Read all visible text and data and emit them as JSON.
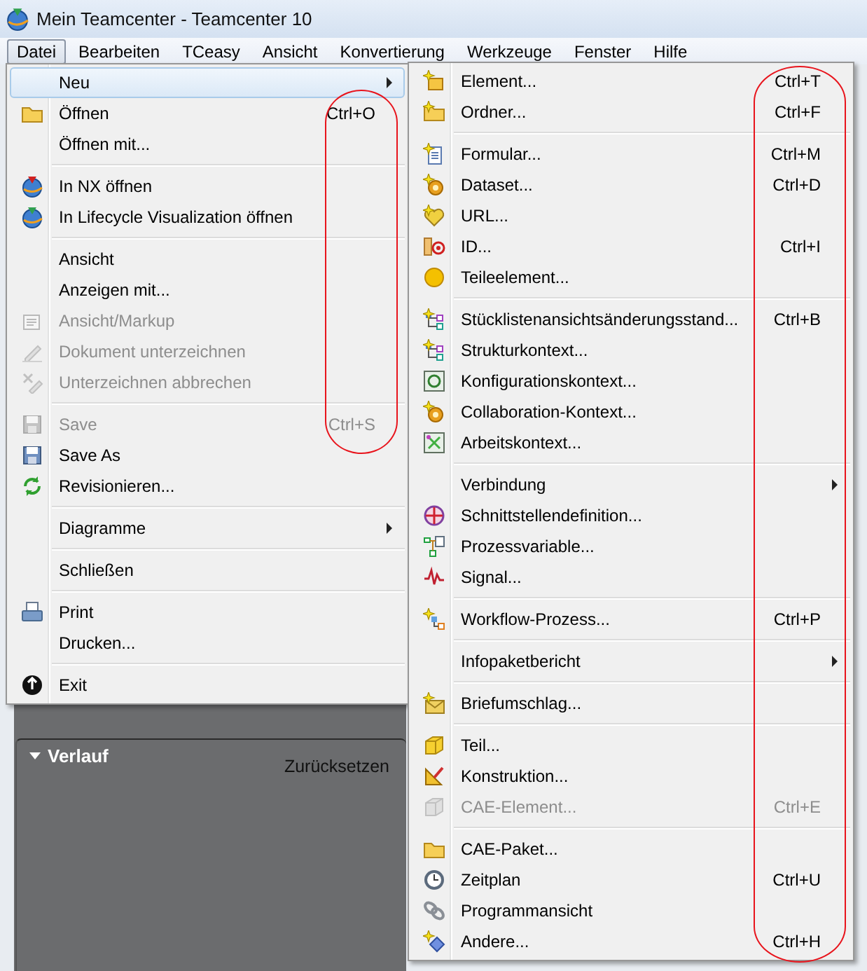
{
  "window": {
    "title": "Mein Teamcenter - Teamcenter 10"
  },
  "menu_bar": [
    {
      "label": "Datei",
      "selected": true
    },
    {
      "label": "Bearbeiten",
      "selected": false
    },
    {
      "label": "TCeasy",
      "selected": false
    },
    {
      "label": "Ansicht",
      "selected": false
    },
    {
      "label": "Konvertierung",
      "selected": false
    },
    {
      "label": "Werkzeuge",
      "selected": false
    },
    {
      "label": "Fenster",
      "selected": false
    },
    {
      "label": "Hilfe",
      "selected": false
    }
  ],
  "file_menu": {
    "groups": [
      {
        "items": [
          {
            "label": "Neu",
            "selected": true,
            "disabled": false,
            "submenu": true
          },
          {
            "label": "Öffnen",
            "shortcut": "Ctrl+O",
            "selected": false,
            "disabled": false,
            "submenu": false
          },
          {
            "label": "Öffnen mit...",
            "selected": false,
            "disabled": false,
            "submenu": false
          }
        ]
      },
      {
        "items": [
          {
            "label": "In NX öffnen",
            "selected": false,
            "disabled": false,
            "submenu": false
          },
          {
            "label": "In Lifecycle Visualization öffnen",
            "selected": false,
            "disabled": false,
            "submenu": false
          }
        ]
      },
      {
        "items": [
          {
            "label": "Ansicht",
            "selected": false,
            "disabled": false,
            "submenu": false
          },
          {
            "label": "Anzeigen mit...",
            "selected": false,
            "disabled": false,
            "submenu": false
          },
          {
            "label": "Ansicht/Markup",
            "selected": false,
            "disabled": true,
            "submenu": false
          },
          {
            "label": "Dokument unterzeichnen",
            "selected": false,
            "disabled": true,
            "submenu": false
          },
          {
            "label": "Unterzeichnen abbrechen",
            "selected": false,
            "disabled": true,
            "submenu": false
          }
        ]
      },
      {
        "items": [
          {
            "label": "Save",
            "shortcut": "Ctrl+S",
            "selected": false,
            "disabled": true,
            "submenu": false
          },
          {
            "label": "Save As",
            "selected": false,
            "disabled": false,
            "submenu": false
          },
          {
            "label": "Revisionieren...",
            "selected": false,
            "disabled": false,
            "submenu": false
          }
        ]
      },
      {
        "items": [
          {
            "label": "Diagramme",
            "selected": false,
            "disabled": false,
            "submenu": true
          }
        ]
      },
      {
        "items": [
          {
            "label": "Schließen",
            "selected": false,
            "disabled": false,
            "submenu": false
          }
        ]
      },
      {
        "items": [
          {
            "label": "Print",
            "selected": false,
            "disabled": false,
            "submenu": false
          },
          {
            "label": "Drucken...",
            "selected": false,
            "disabled": false,
            "submenu": false
          }
        ]
      },
      {
        "items": [
          {
            "label": "Exit",
            "selected": false,
            "disabled": false,
            "submenu": false
          }
        ]
      }
    ]
  },
  "new_submenu": {
    "groups": [
      {
        "items": [
          {
            "label": "Element...",
            "shortcut": "Ctrl+T",
            "selected": false,
            "disabled": false,
            "submenu": false
          },
          {
            "label": "Ordner...",
            "shortcut": "Ctrl+F",
            "selected": false,
            "disabled": false,
            "submenu": false
          }
        ]
      },
      {
        "items": [
          {
            "label": "Formular...",
            "shortcut": "Ctrl+M",
            "selected": false,
            "disabled": false,
            "submenu": false
          },
          {
            "label": "Dataset...",
            "shortcut": "Ctrl+D",
            "selected": false,
            "disabled": false,
            "submenu": false
          },
          {
            "label": "URL...",
            "selected": false,
            "disabled": false,
            "submenu": false
          },
          {
            "label": "ID...",
            "shortcut": "Ctrl+I",
            "selected": false,
            "disabled": false,
            "submenu": false
          },
          {
            "label": "Teileelement...",
            "selected": false,
            "disabled": false,
            "submenu": false
          }
        ]
      },
      {
        "items": [
          {
            "label": "Stücklistenansichtsänderungsstand...",
            "shortcut": "Ctrl+B",
            "selected": false,
            "disabled": false,
            "submenu": false
          },
          {
            "label": "Strukturkontext...",
            "selected": false,
            "disabled": false,
            "submenu": false
          },
          {
            "label": "Konfigurationskontext...",
            "selected": false,
            "disabled": false,
            "submenu": false
          },
          {
            "label": "Collaboration-Kontext...",
            "selected": false,
            "disabled": false,
            "submenu": false
          },
          {
            "label": "Arbeitskontext...",
            "selected": false,
            "disabled": false,
            "submenu": false
          }
        ]
      },
      {
        "items": [
          {
            "label": "Verbindung",
            "selected": false,
            "disabled": false,
            "submenu": true
          },
          {
            "label": "Schnittstellendefinition...",
            "selected": false,
            "disabled": false,
            "submenu": false
          },
          {
            "label": "Prozessvariable...",
            "selected": false,
            "disabled": false,
            "submenu": false
          },
          {
            "label": "Signal...",
            "selected": false,
            "disabled": false,
            "submenu": false
          }
        ]
      },
      {
        "items": [
          {
            "label": "Workflow-Prozess...",
            "shortcut": "Ctrl+P",
            "selected": false,
            "disabled": false,
            "submenu": false
          }
        ]
      },
      {
        "items": [
          {
            "label": "Infopaketbericht",
            "selected": false,
            "disabled": false,
            "submenu": true
          }
        ]
      },
      {
        "items": [
          {
            "label": "Briefumschlag...",
            "selected": false,
            "disabled": false,
            "submenu": false
          }
        ]
      },
      {
        "items": [
          {
            "label": "Teil...",
            "selected": false,
            "disabled": false,
            "submenu": false
          },
          {
            "label": "Konstruktion...",
            "selected": false,
            "disabled": false,
            "submenu": false
          },
          {
            "label": "CAE-Element...",
            "shortcut": "Ctrl+E",
            "selected": false,
            "disabled": true,
            "submenu": false
          }
        ]
      },
      {
        "items": [
          {
            "label": "CAE-Paket...",
            "selected": false,
            "disabled": false,
            "submenu": false
          },
          {
            "label": "Zeitplan",
            "shortcut": "Ctrl+U",
            "selected": false,
            "disabled": false,
            "submenu": false
          },
          {
            "label": "Programmansicht",
            "selected": false,
            "disabled": false,
            "submenu": false
          },
          {
            "label": "Andere...",
            "shortcut": "Ctrl+H",
            "selected": false,
            "disabled": false,
            "submenu": false
          }
        ]
      }
    ]
  },
  "history_panel": {
    "title": "Verlauf",
    "expanded": true,
    "action": "Zurücksetzen"
  },
  "annotations": [
    {
      "kind": "outline"
    },
    {
      "kind": "outline"
    }
  ]
}
